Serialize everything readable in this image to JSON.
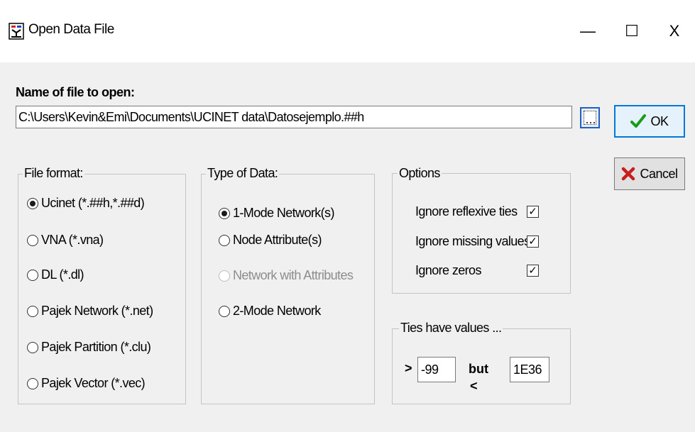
{
  "window": {
    "title": "Open Data File",
    "minimize": "—",
    "maximize": "☐",
    "close": "X"
  },
  "file": {
    "label": "Name of file to open:",
    "path": "C:\\Users\\Kevin&Emi\\Documents\\UCINET data\\Datosejemplo.##h"
  },
  "buttons": {
    "ok": "OK",
    "cancel": "Cancel"
  },
  "file_format": {
    "legend": "File format:",
    "options": [
      {
        "label": "Ucinet (*.##h,*.##d)",
        "checked": true
      },
      {
        "label": "VNA (*.vna)",
        "checked": false
      },
      {
        "label": "DL (*.dl)",
        "checked": false
      },
      {
        "label": "Pajek Network (*.net)",
        "checked": false
      },
      {
        "label": "Pajek Partition (*.clu)",
        "checked": false
      },
      {
        "label": "Pajek Vector (*.vec)",
        "checked": false
      }
    ]
  },
  "type_of_data": {
    "legend": "Type of Data:",
    "options": [
      {
        "label": "1-Mode Network(s)",
        "checked": true,
        "enabled": true
      },
      {
        "label": "Node Attribute(s)",
        "checked": false,
        "enabled": true
      },
      {
        "label": "Network with Attributes",
        "checked": false,
        "enabled": false
      },
      {
        "label": "2-Mode Network",
        "checked": false,
        "enabled": true
      }
    ]
  },
  "options": {
    "legend": "Options",
    "items": [
      {
        "label": "Ignore reflexive ties",
        "checked": true
      },
      {
        "label": "Ignore missing values",
        "checked": true
      },
      {
        "label": "Ignore zeros",
        "checked": true
      }
    ]
  },
  "ties": {
    "legend": "Ties have values ...",
    "greater_symbol": ">",
    "greater_value": "-99",
    "but_label": "but",
    "less_symbol": "<",
    "less_value": "1E36"
  },
  "colors": {
    "accent": "#0078d7",
    "ok_check": "#1a9c1a",
    "cancel_x": "#c81e1e"
  }
}
